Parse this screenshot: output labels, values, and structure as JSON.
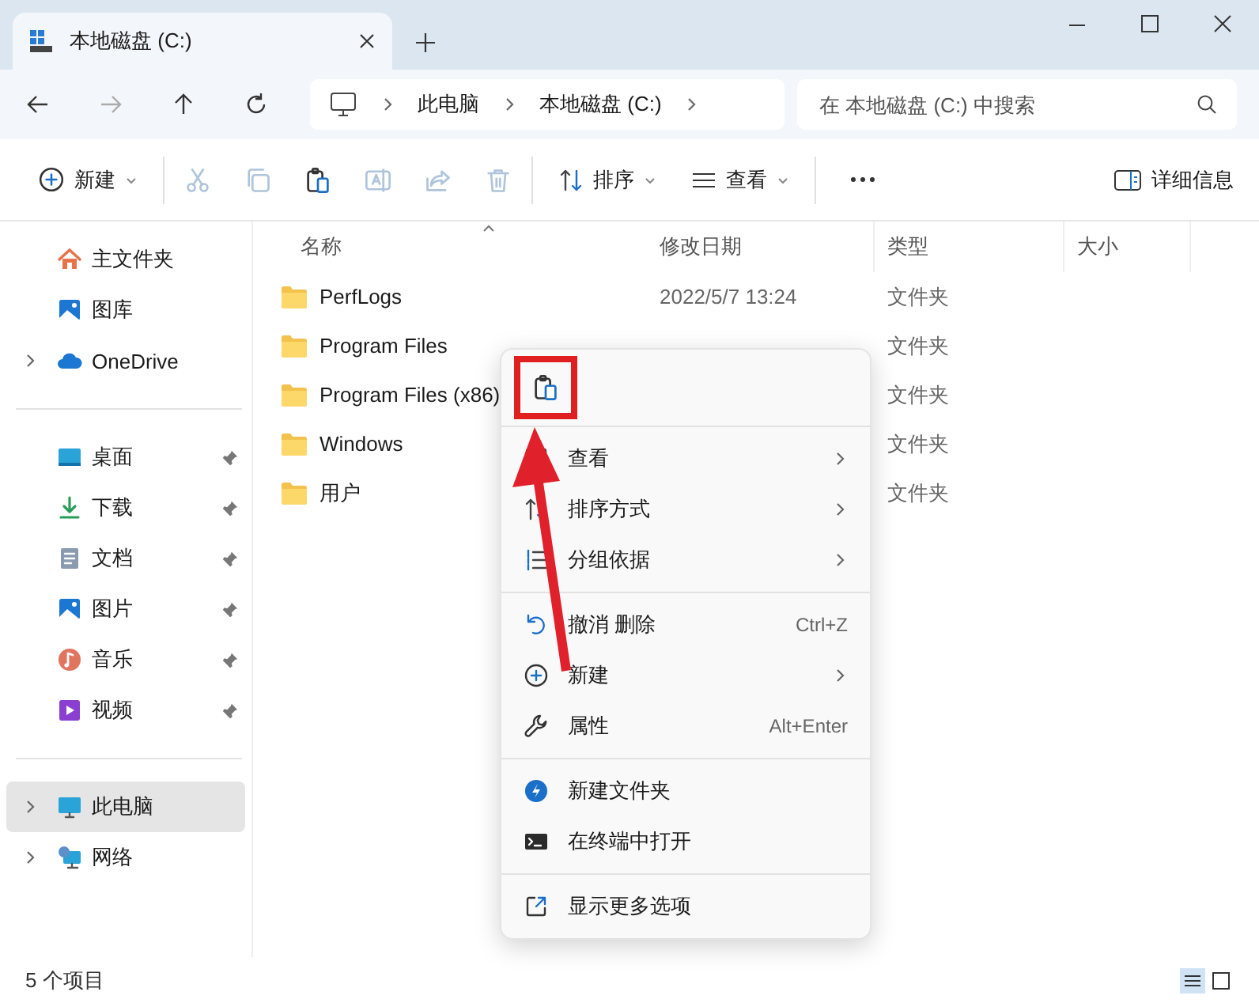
{
  "tab": {
    "title": "本地磁盘 (C:)"
  },
  "address": {
    "crumbs": [
      "此电脑",
      "本地磁盘 (C:)"
    ],
    "search_placeholder": "在 本地磁盘 (C:) 中搜索"
  },
  "toolbar": {
    "new_label": "新建",
    "actions": [
      {
        "kind": "cut",
        "disabled": true
      },
      {
        "kind": "copy",
        "disabled": true
      },
      {
        "kind": "paste",
        "disabled": false
      },
      {
        "kind": "rename",
        "disabled": true
      },
      {
        "kind": "share",
        "disabled": true
      },
      {
        "kind": "delete",
        "disabled": true
      }
    ],
    "sort_label": "排序",
    "view_label": "查看",
    "details_label": "详细信息"
  },
  "sidebar": {
    "groups": [
      [
        {
          "label": "主文件夹",
          "kind": "home",
          "expandable": false,
          "pinned": false,
          "selected": false
        },
        {
          "label": "图库",
          "kind": "gallery",
          "expandable": false,
          "pinned": false,
          "selected": false
        },
        {
          "label": "OneDrive",
          "kind": "cloud",
          "expandable": true,
          "pinned": false,
          "selected": false
        }
      ],
      [
        {
          "label": "桌面",
          "kind": "desktop",
          "expandable": false,
          "pinned": true,
          "selected": false
        },
        {
          "label": "下载",
          "kind": "download",
          "expandable": false,
          "pinned": true,
          "selected": false
        },
        {
          "label": "文档",
          "kind": "document",
          "expandable": false,
          "pinned": true,
          "selected": false
        },
        {
          "label": "图片",
          "kind": "pictures",
          "expandable": false,
          "pinned": true,
          "selected": false
        },
        {
          "label": "音乐",
          "kind": "music",
          "expandable": false,
          "pinned": true,
          "selected": false
        },
        {
          "label": "视频",
          "kind": "video",
          "expandable": false,
          "pinned": true,
          "selected": false
        }
      ],
      [
        {
          "label": "此电脑",
          "kind": "pc",
          "expandable": true,
          "pinned": false,
          "selected": true
        },
        {
          "label": "网络",
          "kind": "network",
          "expandable": true,
          "pinned": false,
          "selected": false
        }
      ]
    ]
  },
  "table": {
    "columns": [
      "名称",
      "修改日期",
      "类型",
      "大小"
    ],
    "rows": [
      {
        "name": "PerfLogs",
        "modified": "2022/5/7 13:24",
        "type": "文件夹"
      },
      {
        "name": "Program Files",
        "type": "文件夹"
      },
      {
        "name": "Program Files (x86)",
        "type": "文件夹"
      },
      {
        "name": "Windows",
        "type": "文件夹"
      },
      {
        "name": "用户",
        "type": "文件夹"
      }
    ]
  },
  "context_menu": {
    "top_actions": [
      {
        "kind": "paste",
        "highlighted": true
      }
    ],
    "sections": [
      [
        {
          "label": "查看",
          "kind": "view",
          "submenu": true
        },
        {
          "label": "排序方式",
          "kind": "sort",
          "submenu": true
        },
        {
          "label": "分组依据",
          "kind": "group",
          "submenu": true
        }
      ],
      [
        {
          "label": "撤消 删除",
          "kind": "undo",
          "shortcut": "Ctrl+Z",
          "submenu": false
        },
        {
          "label": "新建",
          "kind": "new",
          "submenu": true
        },
        {
          "label": "属性",
          "kind": "properties",
          "shortcut": "Alt+Enter",
          "submenu": false
        }
      ],
      [
        {
          "label": "新建文件夹",
          "kind": "newfolder",
          "submenu": false
        },
        {
          "label": "在终端中打开",
          "kind": "terminal",
          "submenu": false
        }
      ],
      [
        {
          "label": "显示更多选项",
          "kind": "more",
          "submenu": false
        }
      ]
    ]
  },
  "status_bar": {
    "count": "5 个项目"
  }
}
